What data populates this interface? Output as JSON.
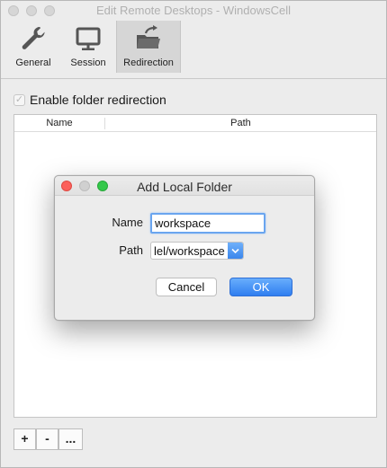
{
  "window": {
    "title": "Edit Remote Desktops - WindowsCell"
  },
  "toolbar": {
    "items": [
      {
        "label": "General",
        "icon": "wrench-icon",
        "selected": false
      },
      {
        "label": "Session",
        "icon": "monitor-icon",
        "selected": false
      },
      {
        "label": "Redirection",
        "icon": "folder-redirect-icon",
        "selected": true
      }
    ]
  },
  "redirection": {
    "enable_label": "Enable folder redirection",
    "enabled": true,
    "columns": [
      "Name",
      "Path"
    ],
    "rows": []
  },
  "buttons": {
    "add": "+",
    "remove": "-",
    "more": "..."
  },
  "dialog": {
    "title": "Add Local Folder",
    "name_label": "Name",
    "name_value": "workspace",
    "path_label": "Path",
    "path_value": "lel/workspace",
    "cancel_label": "Cancel",
    "ok_label": "OK"
  },
  "colors": {
    "accent": "#3b86ec",
    "close": "#fc605b",
    "zoom": "#34c84a"
  }
}
